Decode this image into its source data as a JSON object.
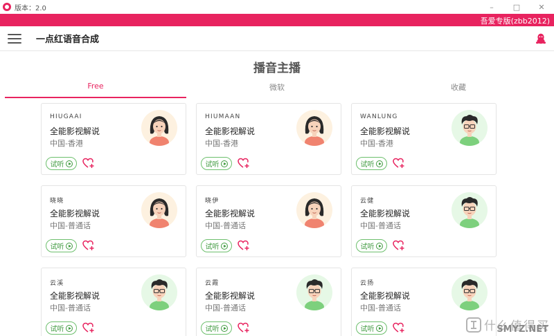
{
  "window": {
    "title": "版本：2.0",
    "controls": {
      "minimize": "–",
      "maximize": "□",
      "close": "✕"
    }
  },
  "banner": {
    "text": "吾爱专版(zbb2012)"
  },
  "header": {
    "app_title": "一点红语音合成",
    "menu_icon": "hamburger-menu-icon",
    "right_icon": "qq-penguin-icon"
  },
  "page": {
    "title": "播音主播"
  },
  "tabs": [
    {
      "label": "Free",
      "active": true
    },
    {
      "label": "微软",
      "active": false
    },
    {
      "label": "收藏",
      "active": false
    }
  ],
  "cards": [
    {
      "code": "HIUGAAI",
      "style": "全能影视解说",
      "lang": "中国-香港",
      "avatar": "female",
      "listen": "试听"
    },
    {
      "code": "HIUMAAN",
      "style": "全能影视解说",
      "lang": "中国-香港",
      "avatar": "female",
      "listen": "试听"
    },
    {
      "code": "WANLUNG",
      "style": "全能影视解说",
      "lang": "中国-香港",
      "avatar": "male",
      "listen": "试听"
    },
    {
      "code": "晓晓",
      "style": "全能影视解说",
      "lang": "中国-普通话",
      "avatar": "female",
      "listen": "试听"
    },
    {
      "code": "晓伊",
      "style": "全能影视解说",
      "lang": "中国-普通话",
      "avatar": "female",
      "listen": "试听"
    },
    {
      "code": "云健",
      "style": "全能影视解说",
      "lang": "中国-普通话",
      "avatar": "male",
      "listen": "试听"
    },
    {
      "code": "云溪",
      "style": "全能影视解说",
      "lang": "中国-普通话",
      "avatar": "male",
      "listen": "试听"
    },
    {
      "code": "云霞",
      "style": "全能影视解说",
      "lang": "中国-普通话",
      "avatar": "male",
      "listen": "试听"
    },
    {
      "code": "云扬",
      "style": "全能影视解说",
      "lang": "中国-普通话",
      "avatar": "male",
      "listen": "试听"
    }
  ],
  "watermark": {
    "main": "什么值得买",
    "site": "SMYZ.NET"
  },
  "colors": {
    "accent": "#e8235f",
    "listen_green": "#3f9a3f",
    "fav_red": "#e8235f"
  }
}
